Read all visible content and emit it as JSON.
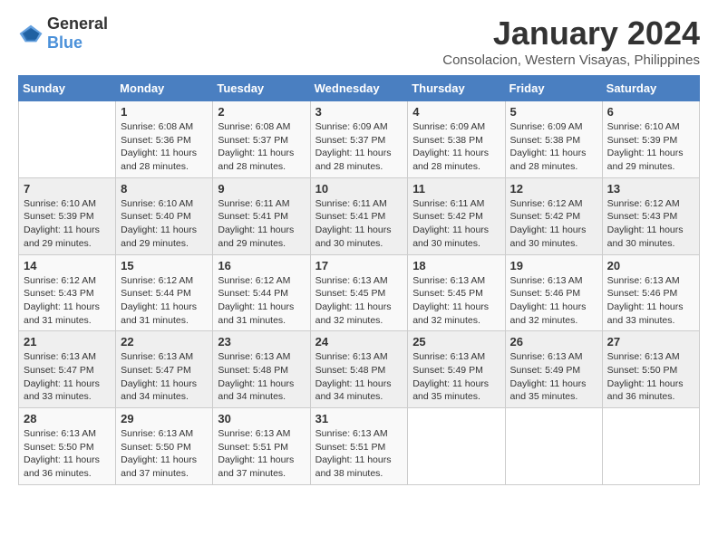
{
  "header": {
    "logo_general": "General",
    "logo_blue": "Blue",
    "month_title": "January 2024",
    "location": "Consolacion, Western Visayas, Philippines"
  },
  "weekdays": [
    "Sunday",
    "Monday",
    "Tuesday",
    "Wednesday",
    "Thursday",
    "Friday",
    "Saturday"
  ],
  "weeks": [
    [
      {
        "day": "",
        "sunrise": "",
        "sunset": "",
        "daylight": ""
      },
      {
        "day": "1",
        "sunrise": "6:08 AM",
        "sunset": "5:36 PM",
        "daylight": "11 hours and 28 minutes."
      },
      {
        "day": "2",
        "sunrise": "6:08 AM",
        "sunset": "5:37 PM",
        "daylight": "11 hours and 28 minutes."
      },
      {
        "day": "3",
        "sunrise": "6:09 AM",
        "sunset": "5:37 PM",
        "daylight": "11 hours and 28 minutes."
      },
      {
        "day": "4",
        "sunrise": "6:09 AM",
        "sunset": "5:38 PM",
        "daylight": "11 hours and 28 minutes."
      },
      {
        "day": "5",
        "sunrise": "6:09 AM",
        "sunset": "5:38 PM",
        "daylight": "11 hours and 28 minutes."
      },
      {
        "day": "6",
        "sunrise": "6:10 AM",
        "sunset": "5:39 PM",
        "daylight": "11 hours and 29 minutes."
      }
    ],
    [
      {
        "day": "7",
        "sunrise": "6:10 AM",
        "sunset": "5:39 PM",
        "daylight": "11 hours and 29 minutes."
      },
      {
        "day": "8",
        "sunrise": "6:10 AM",
        "sunset": "5:40 PM",
        "daylight": "11 hours and 29 minutes."
      },
      {
        "day": "9",
        "sunrise": "6:11 AM",
        "sunset": "5:41 PM",
        "daylight": "11 hours and 29 minutes."
      },
      {
        "day": "10",
        "sunrise": "6:11 AM",
        "sunset": "5:41 PM",
        "daylight": "11 hours and 30 minutes."
      },
      {
        "day": "11",
        "sunrise": "6:11 AM",
        "sunset": "5:42 PM",
        "daylight": "11 hours and 30 minutes."
      },
      {
        "day": "12",
        "sunrise": "6:12 AM",
        "sunset": "5:42 PM",
        "daylight": "11 hours and 30 minutes."
      },
      {
        "day": "13",
        "sunrise": "6:12 AM",
        "sunset": "5:43 PM",
        "daylight": "11 hours and 30 minutes."
      }
    ],
    [
      {
        "day": "14",
        "sunrise": "6:12 AM",
        "sunset": "5:43 PM",
        "daylight": "11 hours and 31 minutes."
      },
      {
        "day": "15",
        "sunrise": "6:12 AM",
        "sunset": "5:44 PM",
        "daylight": "11 hours and 31 minutes."
      },
      {
        "day": "16",
        "sunrise": "6:12 AM",
        "sunset": "5:44 PM",
        "daylight": "11 hours and 31 minutes."
      },
      {
        "day": "17",
        "sunrise": "6:13 AM",
        "sunset": "5:45 PM",
        "daylight": "11 hours and 32 minutes."
      },
      {
        "day": "18",
        "sunrise": "6:13 AM",
        "sunset": "5:45 PM",
        "daylight": "11 hours and 32 minutes."
      },
      {
        "day": "19",
        "sunrise": "6:13 AM",
        "sunset": "5:46 PM",
        "daylight": "11 hours and 32 minutes."
      },
      {
        "day": "20",
        "sunrise": "6:13 AM",
        "sunset": "5:46 PM",
        "daylight": "11 hours and 33 minutes."
      }
    ],
    [
      {
        "day": "21",
        "sunrise": "6:13 AM",
        "sunset": "5:47 PM",
        "daylight": "11 hours and 33 minutes."
      },
      {
        "day": "22",
        "sunrise": "6:13 AM",
        "sunset": "5:47 PM",
        "daylight": "11 hours and 34 minutes."
      },
      {
        "day": "23",
        "sunrise": "6:13 AM",
        "sunset": "5:48 PM",
        "daylight": "11 hours and 34 minutes."
      },
      {
        "day": "24",
        "sunrise": "6:13 AM",
        "sunset": "5:48 PM",
        "daylight": "11 hours and 34 minutes."
      },
      {
        "day": "25",
        "sunrise": "6:13 AM",
        "sunset": "5:49 PM",
        "daylight": "11 hours and 35 minutes."
      },
      {
        "day": "26",
        "sunrise": "6:13 AM",
        "sunset": "5:49 PM",
        "daylight": "11 hours and 35 minutes."
      },
      {
        "day": "27",
        "sunrise": "6:13 AM",
        "sunset": "5:50 PM",
        "daylight": "11 hours and 36 minutes."
      }
    ],
    [
      {
        "day": "28",
        "sunrise": "6:13 AM",
        "sunset": "5:50 PM",
        "daylight": "11 hours and 36 minutes."
      },
      {
        "day": "29",
        "sunrise": "6:13 AM",
        "sunset": "5:50 PM",
        "daylight": "11 hours and 37 minutes."
      },
      {
        "day": "30",
        "sunrise": "6:13 AM",
        "sunset": "5:51 PM",
        "daylight": "11 hours and 37 minutes."
      },
      {
        "day": "31",
        "sunrise": "6:13 AM",
        "sunset": "5:51 PM",
        "daylight": "11 hours and 38 minutes."
      },
      {
        "day": "",
        "sunrise": "",
        "sunset": "",
        "daylight": ""
      },
      {
        "day": "",
        "sunrise": "",
        "sunset": "",
        "daylight": ""
      },
      {
        "day": "",
        "sunrise": "",
        "sunset": "",
        "daylight": ""
      }
    ]
  ],
  "labels": {
    "sunrise_prefix": "Sunrise: ",
    "sunset_prefix": "Sunset: ",
    "daylight_prefix": "Daylight: "
  }
}
